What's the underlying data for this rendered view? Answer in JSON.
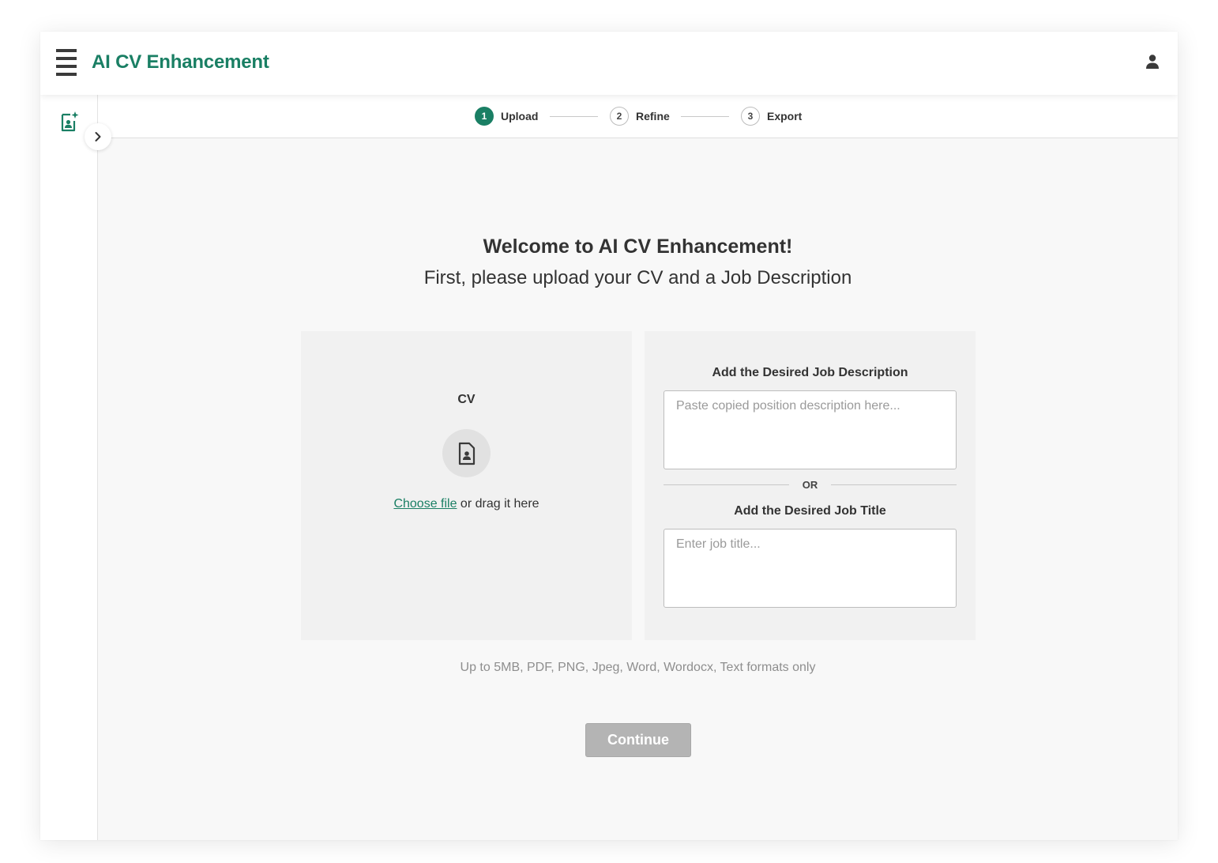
{
  "header": {
    "app_title": "AI CV Enhancement",
    "menu_icon": "hamburger-menu-icon",
    "user_icon": "user-account-icon"
  },
  "sidebar": {
    "doc_icon": "document-sparkle-icon",
    "toggle_icon": "chevron-right-icon"
  },
  "stepper": {
    "steps": [
      {
        "number": "1",
        "label": "Upload",
        "state": "active"
      },
      {
        "number": "2",
        "label": "Refine",
        "state": "inactive"
      },
      {
        "number": "3",
        "label": "Export",
        "state": "inactive"
      }
    ]
  },
  "welcome": {
    "title": "Welcome to AI CV Enhancement!",
    "subtitle": "First, please upload your CV and a Job Description"
  },
  "cv_panel": {
    "label": "CV",
    "icon": "contact-file-icon",
    "choose_file": "Choose file",
    "drag_text": " or drag it here"
  },
  "job_panel": {
    "description_label": "Add the Desired Job Description",
    "description_placeholder": "Paste copied position description here...",
    "description_value": "",
    "or_text": "OR",
    "title_label": "Add the Desired Job Title",
    "title_placeholder": "Enter job title...",
    "title_value": ""
  },
  "formats_note": "Up to 5MB, PDF, PNG, Jpeg, Word, Wordocx, Text formats only",
  "continue_label": "Continue",
  "colors": {
    "accent": "#1a7f64",
    "disabled_button": "#b4b4b4",
    "panel_bg": "#f1f1f1",
    "page_bg": "#f8f8f8"
  }
}
